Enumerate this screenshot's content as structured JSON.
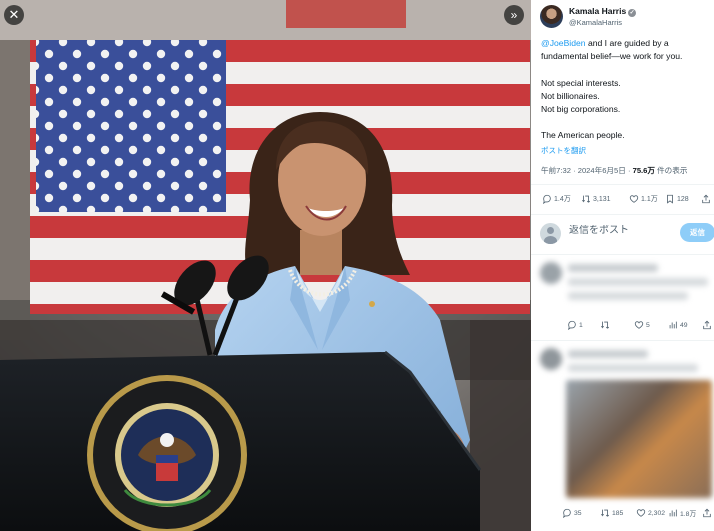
{
  "media": {
    "close_icon": "close-icon",
    "expand_icon": "expand-icon",
    "description_icon": "photo"
  },
  "author": {
    "name": "Kamala Harris",
    "handle": "@KamalaHarris"
  },
  "post": {
    "mention": "@JoeBiden",
    "line1_rest": " and I are guided by a",
    "line2": "fundamental belief—we work for you.",
    "line3": "Not special interests.",
    "line4": "Not billionaires.",
    "line5": "Not big corporations.",
    "line6": "The American people.",
    "translate": "ポストを翻訳",
    "meta_time": "午前7:32 · 2024年6月5日 · ",
    "meta_views": "75.6万",
    "meta_views_suffix": " 件の表示"
  },
  "actions": {
    "replies": "1.4万",
    "reposts": "3,131",
    "likes": "1.1万",
    "bookmarks": "128"
  },
  "reply_box": {
    "placeholder": "返信をポスト",
    "button": "返信"
  },
  "reply1": {
    "replies": "1",
    "reposts": "",
    "likes": "5",
    "views": "49"
  },
  "reply2": {
    "replies": "35",
    "reposts": "185",
    "likes": "2,302",
    "views": "1.8万"
  },
  "colors": {
    "accent": "#1d9bf0",
    "reply_button": "#8ecdf8",
    "blazer": "#9cc3e8"
  }
}
